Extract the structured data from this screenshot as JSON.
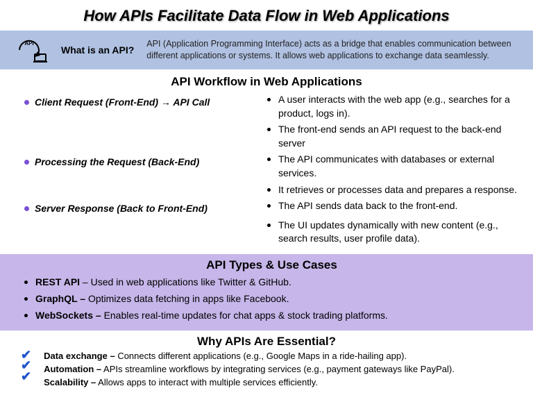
{
  "title": "How APIs Facilitate Data Flow in Web Applications",
  "intro": {
    "question": "What is an API?",
    "answer": "API (Application Programming Interface) acts as a bridge that enables communication between different applications or systems. It allows web applications to exchange data seamlessly."
  },
  "workflow": {
    "title": "API Workflow in Web Applications",
    "steps": [
      {
        "heading": "Client Request (Front-End) → API Call",
        "points": [
          "A user interacts with the web app (e.g., searches for a product, logs in).",
          "The front-end sends an API request to the back-end server"
        ]
      },
      {
        "heading": "Processing the Request (Back-End)",
        "points": [
          "The API communicates with databases or external services.",
          "It retrieves or processes data and prepares a response."
        ]
      },
      {
        "heading": "Server Response (Back to Front-End)",
        "points": [
          "The API sends data back to the front-end.",
          "The UI updates dynamically with new content (e.g., search results, user profile data)."
        ]
      }
    ]
  },
  "types": {
    "title": "API Types & Use Cases",
    "items": [
      {
        "name": "REST API",
        "sep": " – ",
        "desc": "Used in web applications like Twitter & GitHub."
      },
      {
        "name": "GraphQL –",
        "sep": " ",
        "desc": "Optimizes data fetching in apps like Facebook."
      },
      {
        "name": "WebSockets –",
        "sep": " ",
        "desc": "Enables real-time updates for chat apps & stock trading platforms."
      }
    ]
  },
  "why": {
    "title": "Why APIs Are Essential?",
    "items": [
      {
        "name": "Data exchange –",
        "desc": " Connects different applications (e.g., Google Maps in a ride-hailing app)."
      },
      {
        "name": "Automation –",
        "desc": " APIs streamline workflows by integrating services (e.g., payment gateways like PayPal)."
      },
      {
        "name": "Scalability –",
        "desc": " Allows apps to interact with multiple services efficiently."
      }
    ]
  }
}
